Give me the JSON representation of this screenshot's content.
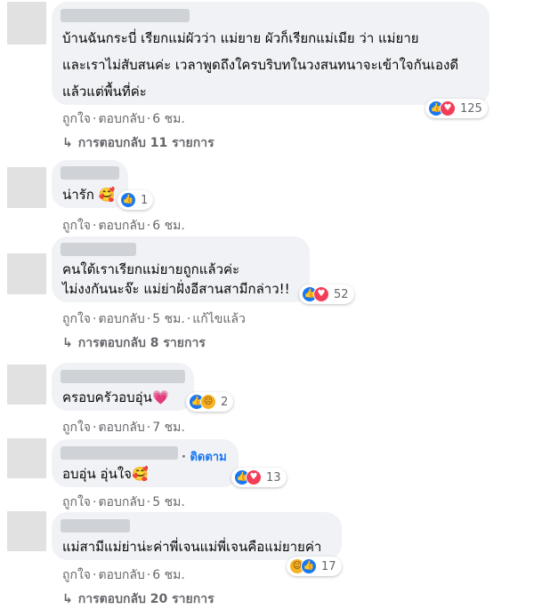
{
  "comments": [
    {
      "lines": [
        "บ้านฉันกระบี่ เรียกแม่ผัวว่า แม่ยาย ผัวก็เรียกแม่เมีย ว่า แม่ยาย",
        "และเราไม่สับสนค่ะ เวลาพูดถึงใครบริบทในวงสนทนาจะเข้าใจกันเองดี",
        "แล้วแต่พื้นที่ค่ะ"
      ],
      "reaction_count": "125",
      "like": "ถูกใจ",
      "reply": "ตอบกลับ",
      "time": "6 ชม.",
      "replies_label": "การตอบกลับ 11 รายการ"
    },
    {
      "lines": [
        "น่ารัก"
      ],
      "emoji": "🥰",
      "reaction_count": "1",
      "like": "ถูกใจ",
      "reply": "ตอบกลับ",
      "time": "6 ชม."
    },
    {
      "lines": [
        "คนใต้เราเรียกแม่ยายถูกแล้วค่ะ",
        "ไม่งงกันนะจ๊ะ แม่ย่าฝั่งอีสานสามีกล่าว!!"
      ],
      "reaction_count": "52",
      "like": "ถูกใจ",
      "reply": "ตอบกลับ",
      "time": "5 ชม.",
      "edited": "แก้ไขแล้ว",
      "replies_label": "การตอบกลับ 8 รายการ"
    },
    {
      "lines": [
        "ครอบครัวอบอุ่น"
      ],
      "emoji": "💗",
      "reaction_count": "2",
      "like": "ถูกใจ",
      "reply": "ตอบกลับ",
      "time": "7 ชม."
    },
    {
      "follow": "ติดตาม",
      "lines": [
        "อบอุ่น อุ่นใจ"
      ],
      "emoji": "🥰",
      "reaction_count": "13",
      "like": "ถูกใจ",
      "reply": "ตอบกลับ",
      "time": "5 ชม."
    },
    {
      "lines": [
        "แม่สามีแม่ย่าน่ะค่าพี่เจนแม่พี่เจนคือแม่ยายค่า"
      ],
      "reaction_count": "17",
      "like": "ถูกใจ",
      "reply": "ตอบกลับ",
      "time": "6 ชม.",
      "replies_label": "การตอบกลับ 20 รายการ"
    }
  ],
  "icons": {
    "separator": "·",
    "reply_arrow": "↳",
    "like": "like-reaction-icon",
    "love": "love-reaction-icon",
    "haha": "haha-reaction-icon",
    "sad": "sad-reaction-icon"
  },
  "colors": {
    "bubble": "#f0f2f5",
    "meta": "#65676b",
    "like": "#1877f2",
    "love": "#f33e58"
  }
}
